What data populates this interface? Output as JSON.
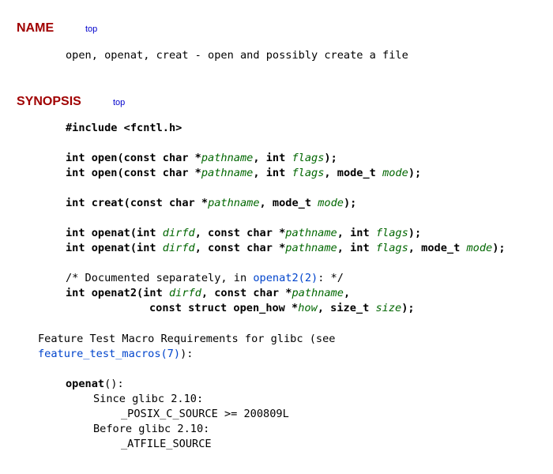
{
  "name_section": {
    "heading": "NAME",
    "top_link": "top",
    "description": "open, openat, creat - open and possibly create a file"
  },
  "synopsis_section": {
    "heading": "SYNOPSIS",
    "top_link": "top",
    "include": "#include <fcntl.h>",
    "lines": {
      "open1": {
        "a": "int open(const char *",
        "b": "pathname",
        "c": ", int ",
        "d": "flags",
        "e": ");"
      },
      "open2": {
        "a": "int open(const char *",
        "b": "pathname",
        "c": ", int ",
        "d": "flags",
        "e": ", mode_t ",
        "f": "mode",
        "g": ");"
      },
      "creat": {
        "a": "int creat(const char *",
        "b": "pathname",
        "c": ", mode_t ",
        "d": "mode",
        "e": ");"
      },
      "openat1": {
        "a": "int openat(int ",
        "b": "dirfd",
        "c": ", const char *",
        "d": "pathname",
        "e": ", int ",
        "f": "flags",
        "g": ");"
      },
      "openat2_line": {
        "a": "int openat(int ",
        "b": "dirfd",
        "c": ", const char *",
        "d": "pathname",
        "e": ", int ",
        "f": "flags",
        "g": ", mode_t ",
        "h": "mode",
        "i": ");"
      },
      "comment": {
        "a": "/* Documented separately, in ",
        "link": "openat2(2)",
        "b": ": */"
      },
      "openat2_a": {
        "a": "int openat2(int ",
        "b": "dirfd",
        "c": ", const char *",
        "d": "pathname",
        "e": ","
      },
      "openat2_b": {
        "a": "const struct open_how *",
        "b": "how",
        "c": ", size_t ",
        "d": "size",
        "e": ");"
      }
    },
    "feature_test": {
      "line1": "Feature Test Macro Requirements for glibc (see",
      "link": "feature_test_macros(7)",
      "line2_suffix": "):",
      "func": "openat",
      "func_suffix": "():",
      "since": "Since glibc 2.10:",
      "since_macro": "_POSIX_C_SOURCE >= 200809L",
      "before": "Before glibc 2.10:",
      "before_macro": "_ATFILE_SOURCE"
    }
  }
}
